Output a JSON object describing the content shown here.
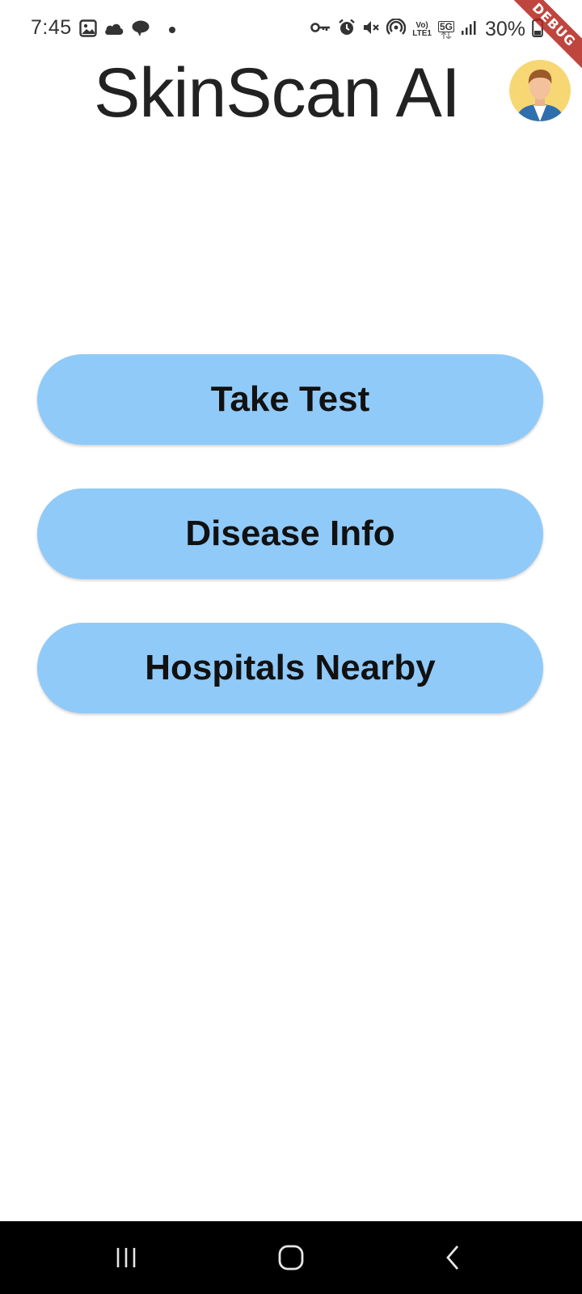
{
  "status_bar": {
    "time": "7:45",
    "battery_text": "30%",
    "network_volte_line1": "Vo)",
    "network_volte_line2": "LTE1",
    "network_5g": "5G",
    "left_icons": [
      "image-icon",
      "cloud-icon",
      "chat-bubble-icon",
      "dot-icon"
    ],
    "right_icons": [
      "key-icon",
      "alarm-icon",
      "mute-icon",
      "hotspot-icon",
      "volte-icon",
      "5g-icon",
      "signal-icon",
      "battery-icon"
    ]
  },
  "debug_banner": "DEBUG",
  "app_bar": {
    "title": "SkinScan AI",
    "avatar_icon": "user-avatar-icon"
  },
  "menu": {
    "buttons": [
      {
        "label": "Take Test"
      },
      {
        "label": "Disease Info"
      },
      {
        "label": "Hospitals Nearby"
      }
    ],
    "button_color": "#90caf9"
  },
  "nav_bar": {
    "items": [
      "recent-apps-icon",
      "home-icon",
      "back-icon"
    ]
  }
}
